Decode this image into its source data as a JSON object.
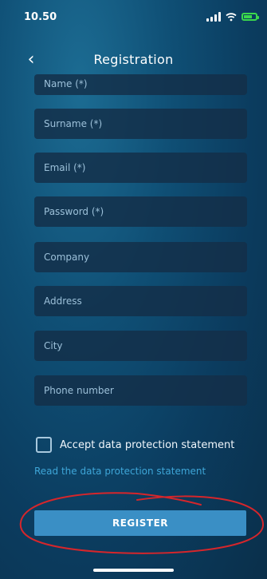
{
  "status_bar": {
    "time": "10.50",
    "icons": [
      "signal-icon",
      "wifi-icon",
      "battery-charging-icon"
    ],
    "battery_color": "#3bd84c"
  },
  "header": {
    "back_icon": "chevron-left-icon",
    "title": "Registration"
  },
  "form": {
    "fields": [
      {
        "placeholder": "Name (*)"
      },
      {
        "placeholder": "Surname (*)"
      },
      {
        "placeholder": "Email (*)"
      },
      {
        "placeholder": "Password (*)"
      },
      {
        "placeholder": "Company"
      },
      {
        "placeholder": "Address"
      },
      {
        "placeholder": "City"
      },
      {
        "placeholder": "Phone number"
      }
    ],
    "accept_label": "Accept data protection statement",
    "read_link": "Read the data protection statement",
    "register_label": "REGISTER"
  },
  "colors": {
    "background": "#0f4f75",
    "field_background": "#142e48",
    "link": "#3ea6d8",
    "button": "#3a8fc5",
    "annotation": "#d6262b"
  }
}
